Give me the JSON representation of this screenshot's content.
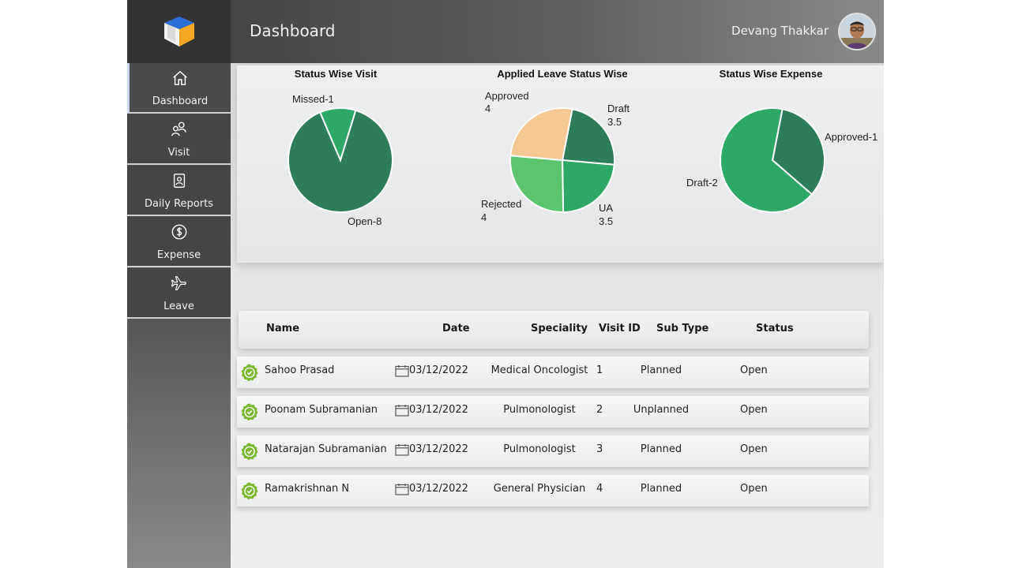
{
  "header": {
    "title": "Dashboard",
    "user_name": "Devang Thakkar"
  },
  "sidebar": {
    "items": [
      {
        "label": "Dashboard",
        "icon": "home-icon"
      },
      {
        "label": "Visit",
        "icon": "people-icon"
      },
      {
        "label": "Daily Reports",
        "icon": "report-icon"
      },
      {
        "label": "Expense",
        "icon": "dollar-icon"
      },
      {
        "label": "Leave",
        "icon": "airplane-icon"
      }
    ]
  },
  "chart_data": [
    {
      "type": "pie",
      "title": "Status Wise Visit",
      "labels": [
        "Open-8",
        "Missed-1"
      ],
      "values": [
        8,
        1
      ]
    },
    {
      "type": "pie",
      "title": "Applied Leave Status Wise",
      "labels": [
        [
          "Draft",
          "3.5"
        ],
        [
          "UA",
          "3.5"
        ],
        [
          "Rejected",
          "4"
        ],
        [
          "Approved",
          "4"
        ]
      ],
      "values": [
        3.5,
        3.5,
        4,
        4
      ]
    },
    {
      "type": "pie",
      "title": "Status Wise Expense",
      "labels": [
        "Approved-1",
        "Draft-2"
      ],
      "values": [
        1,
        2
      ]
    }
  ],
  "colors": {
    "dark_green": "#2e7d5a",
    "mid_green": "#2ea866",
    "light_green": "#5cc46c",
    "peach": "#f5c792",
    "check_green": "#7cb82f"
  },
  "table": {
    "columns": [
      "Name",
      "Date",
      "Speciality",
      "Visit ID",
      "Sub Type",
      "Status"
    ],
    "rows": [
      {
        "name": "Sahoo Prasad",
        "date": "03/12/2022",
        "speciality": "Medical Oncologist",
        "visit_id": "1",
        "sub_type": "Planned",
        "status": "Open"
      },
      {
        "name": "Poonam Subramanian",
        "date": "03/12/2022",
        "speciality": "Pulmonologist",
        "visit_id": "2",
        "sub_type": "Unplanned",
        "status": "Open"
      },
      {
        "name": "Natarajan Subramanian",
        "date": "03/12/2022",
        "speciality": "Pulmonologist",
        "visit_id": "3",
        "sub_type": "Planned",
        "status": "Open"
      },
      {
        "name": "Ramakrishnan N",
        "date": "03/12/2022",
        "speciality": "General Physician",
        "visit_id": "4",
        "sub_type": "Planned",
        "status": "Open"
      }
    ]
  }
}
